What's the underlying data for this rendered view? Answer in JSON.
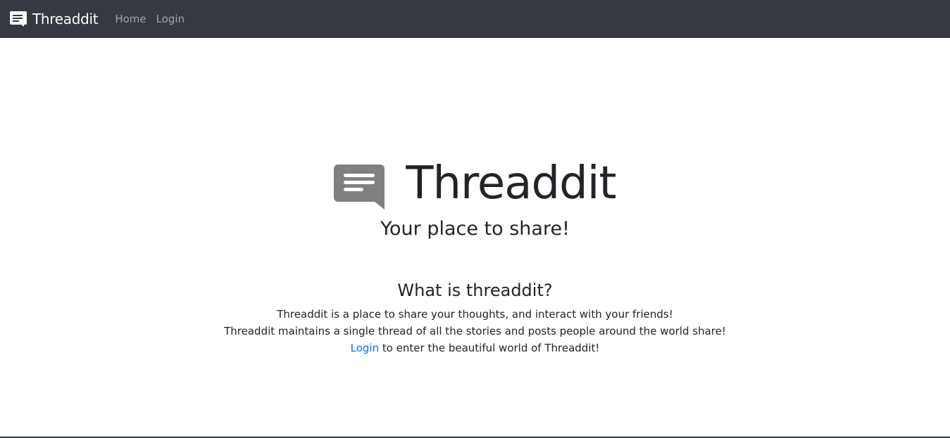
{
  "navbar": {
    "brand": {
      "label": "Threaddit",
      "icon": "chat-message-icon"
    },
    "links": [
      {
        "label": "Home"
      },
      {
        "label": "Login"
      }
    ],
    "background": "#343a40"
  },
  "hero": {
    "icon": "chat-message-icon",
    "title": "Threaddit",
    "tagline": "Your place to share!"
  },
  "about": {
    "heading": "What is threaddit?",
    "line1": "Threaddit is a place to share your thoughts, and interact with your friends!",
    "line2": "Threaddit maintains a single thread of all the stories and posts people around the world share!",
    "login_link": "Login",
    "line3_rest": " to enter the beautiful world of Threaddit!"
  },
  "colors": {
    "link": "#0d6efd",
    "hero_icon": "#808080"
  }
}
